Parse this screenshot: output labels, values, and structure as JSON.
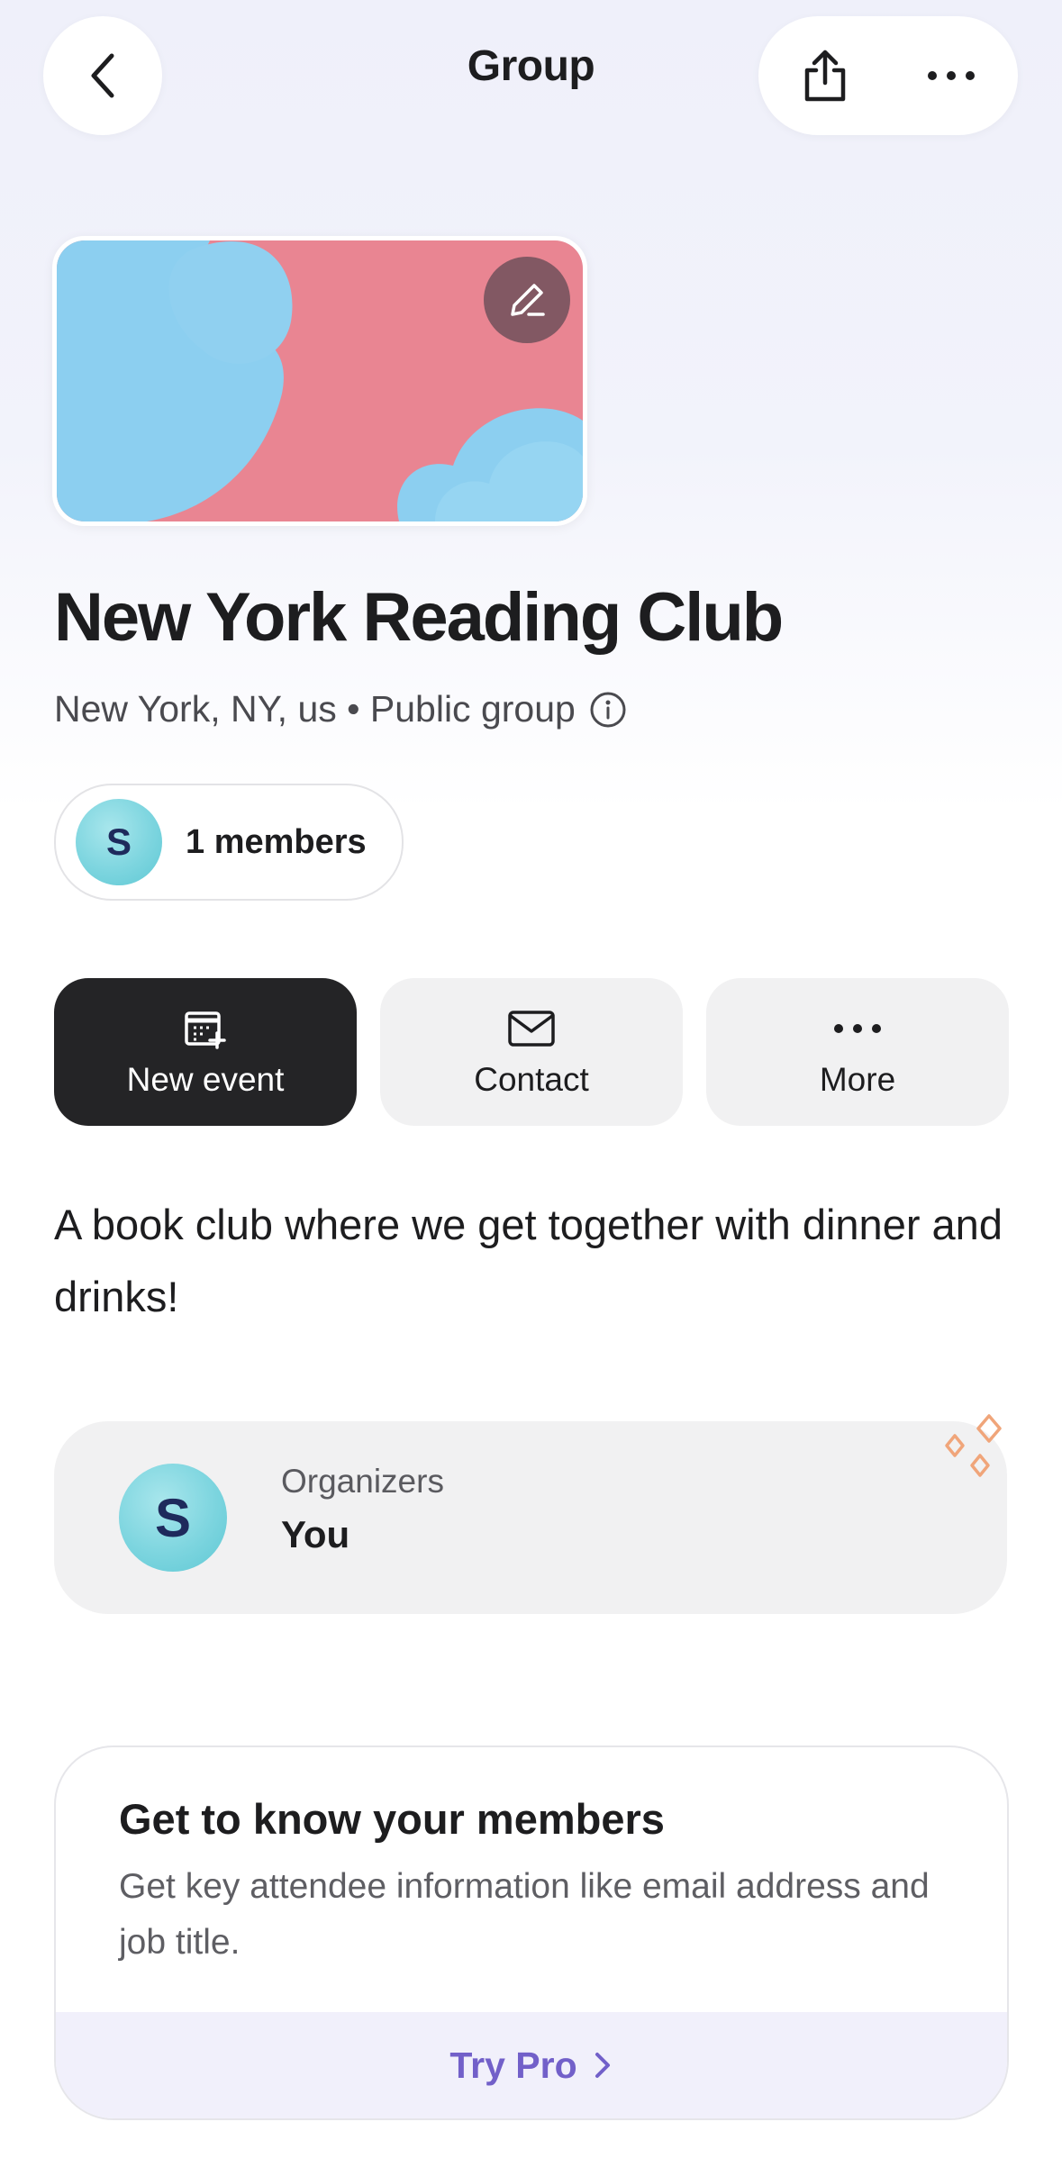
{
  "header": {
    "title": "Group"
  },
  "group": {
    "name": "New York Reading Club",
    "meta": "New York, NY, us • Public group",
    "members_label": "1 members",
    "member_initial": "S",
    "description": "A book club where we get together with dinner and drinks!"
  },
  "actions": [
    {
      "label": "New event",
      "icon": "calendar-plus-icon"
    },
    {
      "label": "Contact",
      "icon": "envelope-icon"
    },
    {
      "label": "More",
      "icon": "more-dots-icon"
    }
  ],
  "organizers": {
    "label": "Organizers",
    "name": "You",
    "initial": "S"
  },
  "promo": {
    "title": "Get to know your members",
    "text": "Get key attendee information like email address and job title.",
    "link": "Try Pro"
  },
  "colors": {
    "accent": "#7260c9",
    "primary_button": "#242426",
    "avatar": "#7dd5df",
    "cover_pink": "#e8818f",
    "cover_blue": "#8ccff0",
    "sparkle": "#f0a57a"
  }
}
